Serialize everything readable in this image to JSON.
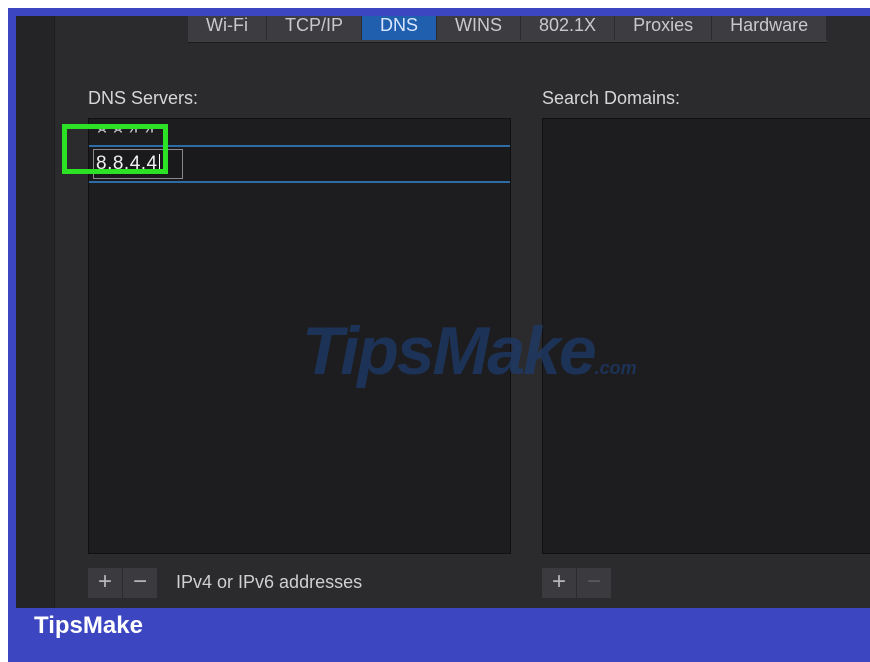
{
  "tabs": [
    "Wi-Fi",
    "TCP/IP",
    "DNS",
    "WINS",
    "802.1X",
    "Proxies",
    "Hardware"
  ],
  "active_tab": "DNS",
  "dns": {
    "label": "DNS Servers:",
    "items": [
      "8.8.4.4"
    ],
    "editing_value": "8.8.4.4",
    "hint": "IPv4 or IPv6 addresses"
  },
  "search": {
    "label": "Search Domains:"
  },
  "buttons": {
    "add": "+",
    "remove": "−"
  },
  "watermark": {
    "main": "TipsMake",
    "suffix": ".com"
  },
  "footer": {
    "brand": "TipsMake"
  },
  "colors": {
    "frame": "#3c46c1",
    "highlight": "#2be225",
    "active_tab": "#1f5fae"
  }
}
